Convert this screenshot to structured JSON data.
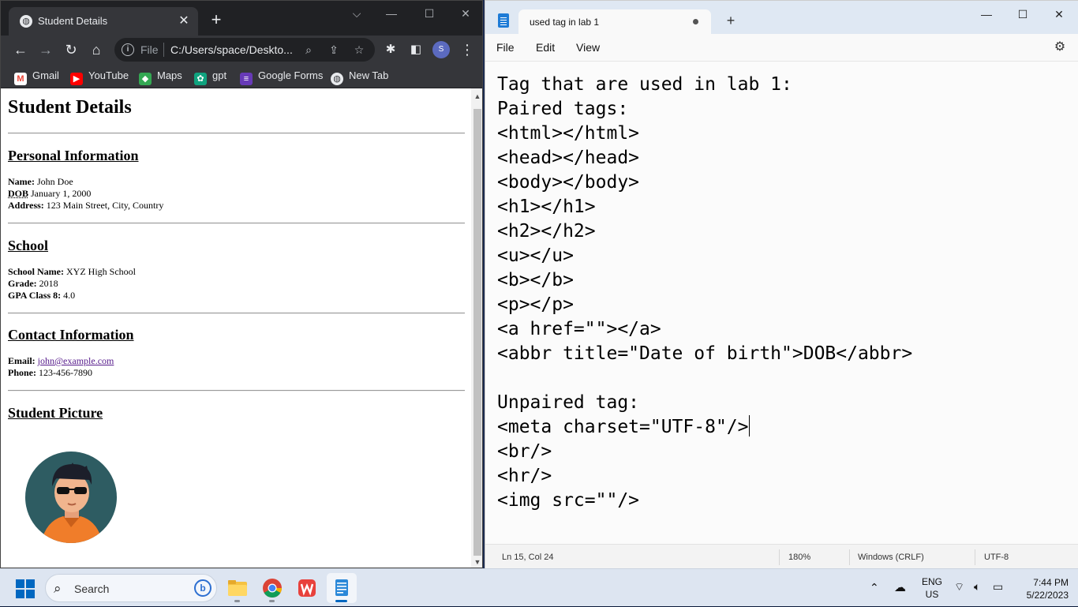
{
  "browser": {
    "tab_title": "Student Details",
    "tab_close": "✕",
    "new_tab": "+",
    "window_controls": [
      "⌵",
      "—",
      "☐",
      "✕"
    ],
    "scheme_label": "File",
    "url": "C:/Users/space/Deskto...",
    "profile_initial": "S",
    "bookmarks": [
      {
        "label": "Gmail",
        "icon": "gmail-icon",
        "color": "#ea4335"
      },
      {
        "label": "YouTube",
        "icon": "youtube-icon",
        "color": "#ff0000"
      },
      {
        "label": "Maps",
        "icon": "maps-icon",
        "color": "#34a853"
      },
      {
        "label": "gpt",
        "icon": "chatgpt-icon",
        "color": "#10a37f"
      },
      {
        "label": "Google Forms",
        "icon": "forms-icon",
        "color": "#673ab7"
      },
      {
        "label": "New Tab",
        "icon": "chrome-icon",
        "color": "#e8eaed"
      }
    ]
  },
  "page": {
    "title": "Student Details",
    "sections": {
      "personal": {
        "heading": "Personal Information",
        "name_label": "Name:",
        "name_value": "John Doe",
        "dob_label": "DOB",
        "dob_value": "January 1, 2000",
        "address_label": "Address:",
        "address_value": "123 Main Street, City, Country"
      },
      "school": {
        "heading": "School",
        "school_label": "School Name:",
        "school_value": "XYZ High School",
        "grade_label": "Grade:",
        "grade_value": "2018",
        "gpa_label": "GPA Class 8:",
        "gpa_value": "4.0"
      },
      "contact": {
        "heading": "Contact Information",
        "email_label": "Email:",
        "email_value": "john@example.com",
        "phone_label": "Phone:",
        "phone_value": "123-456-7890"
      },
      "picture": {
        "heading": "Student Picture"
      }
    }
  },
  "notepad": {
    "tab_title": "used tag in lab 1",
    "new_tab": "+",
    "window_controls": [
      "—",
      "☐",
      "✕"
    ],
    "menu": {
      "file": "File",
      "edit": "Edit",
      "view": "View"
    },
    "lines_before_caret": "Tag that are used in lab 1:\nPaired tags:\n<html></html>\n<head></head>\n<body></body>\n<h1></h1>\n<h2></h2>\n<u></u>\n<b></b>\n<p></p>\n<a href=\"\"></a>\n<abbr title=\"Date of birth\">DOB</abbr>\n\nUnpaired tag:\n<meta charset=\"UTF-8\"/>",
    "lines_after_caret": "\n<br/>\n<hr/>\n<img src=\"\"/>",
    "status": {
      "position": "Ln 15, Col 24",
      "zoom": "180%",
      "line_ending": "Windows (CRLF)",
      "encoding": "UTF-8"
    }
  },
  "taskbar": {
    "search_placeholder": "Search",
    "tray": {
      "lang_line1": "ENG",
      "lang_line2": "US"
    },
    "time": "7:44 PM",
    "date": "5/22/2023",
    "accent": "#0067c0"
  }
}
